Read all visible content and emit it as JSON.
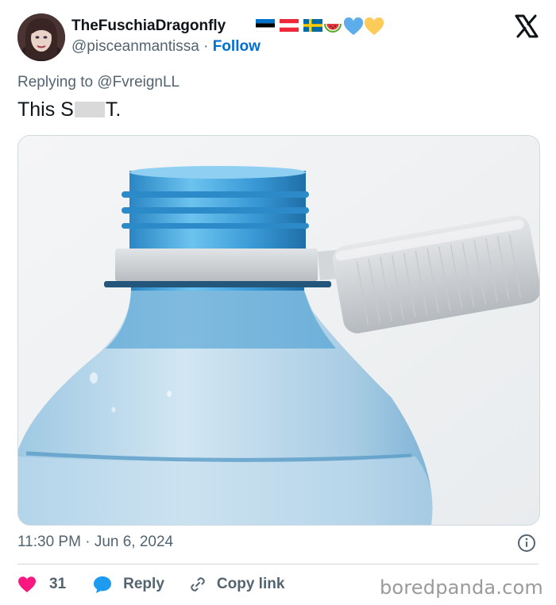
{
  "author": {
    "display_name": "TheFuschiaDragonfly",
    "handle": "@pisceanmantissa",
    "separator": "·",
    "follow_label": "Follow",
    "flags": [
      "estonia-flag",
      "austria-flag",
      "sweden-flag"
    ],
    "emojis": [
      "watermelon-emoji",
      "blue-heart-emoji",
      "yellow-heart-emoji"
    ]
  },
  "reply_context": {
    "prefix": "Replying to",
    "handle": "@FvreignLL"
  },
  "tweet": {
    "text_before": "This S",
    "text_after": "T.",
    "media_alt": "plastic water bottle with tethered cap"
  },
  "meta": {
    "time": "11:30 PM",
    "separator": "·",
    "date": "Jun 6, 2024"
  },
  "actions": {
    "like_count": "31",
    "reply_label": "Reply",
    "copy_link_label": "Copy link"
  },
  "watermark": "boredpanda.com",
  "colors": {
    "like": "#f91880",
    "reply": "#1d9bf0",
    "follow": "#006fd6",
    "muted": "#536471",
    "text": "#0f1419"
  }
}
